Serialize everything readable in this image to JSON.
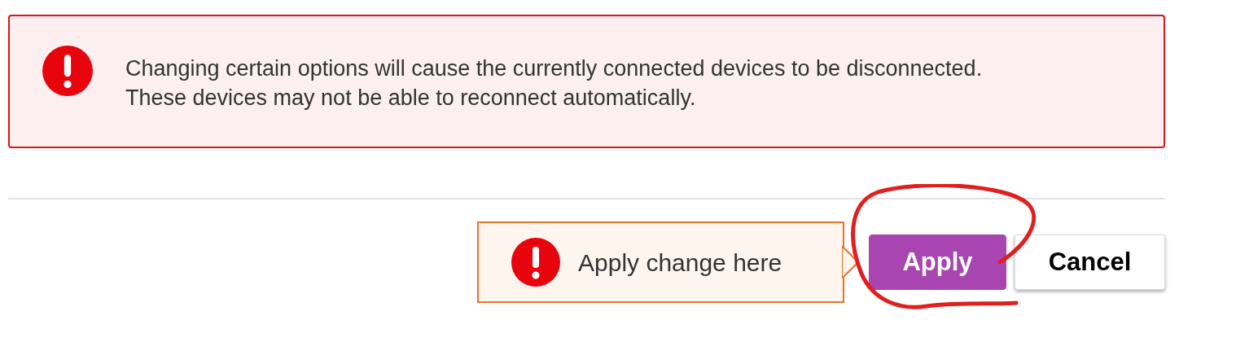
{
  "alert": {
    "kind": "error",
    "message": "Changing certain options will cause the currently connected devices to be disconnected. These devices may not be able to reconnect automatically."
  },
  "callout": {
    "text": "Apply change here"
  },
  "buttons": [
    {
      "label": "Apply",
      "kind": "primary"
    },
    {
      "label": "Cancel",
      "kind": "secondary"
    }
  ]
}
